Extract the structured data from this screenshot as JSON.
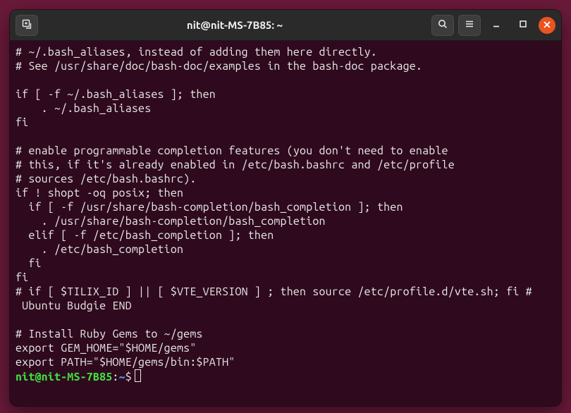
{
  "window": {
    "title": "nit@nit-MS-7B85: ~"
  },
  "icons": {
    "newtab": "new-tab-icon",
    "search": "search-icon",
    "menu": "hamburger-icon",
    "minimize": "minimize-icon",
    "maximize": "maximize-icon",
    "close": "close-icon"
  },
  "content_lines": [
    "# ~/.bash_aliases, instead of adding them here directly.",
    "# See /usr/share/doc/bash-doc/examples in the bash-doc package.",
    "",
    "if [ -f ~/.bash_aliases ]; then",
    "    . ~/.bash_aliases",
    "fi",
    "",
    "# enable programmable completion features (you don't need to enable",
    "# this, if it's already enabled in /etc/bash.bashrc and /etc/profile",
    "# sources /etc/bash.bashrc).",
    "if ! shopt -oq posix; then",
    "  if [ -f /usr/share/bash-completion/bash_completion ]; then",
    "    . /usr/share/bash-completion/bash_completion",
    "  elif [ -f /etc/bash_completion ]; then",
    "    . /etc/bash_completion",
    "  fi",
    "fi",
    "# if [ $TILIX_ID ] || [ $VTE_VERSION ] ; then source /etc/profile.d/vte.sh; fi #",
    " Ubuntu Budgie END",
    "",
    "# Install Ruby Gems to ~/gems",
    "export GEM_HOME=\"$HOME/gems\"",
    "export PATH=\"$HOME/gems/bin:$PATH\""
  ],
  "prompt": {
    "user_host": "nit@nit-MS-7B85",
    "colon": ":",
    "cwd": "~",
    "symbol": "$"
  }
}
